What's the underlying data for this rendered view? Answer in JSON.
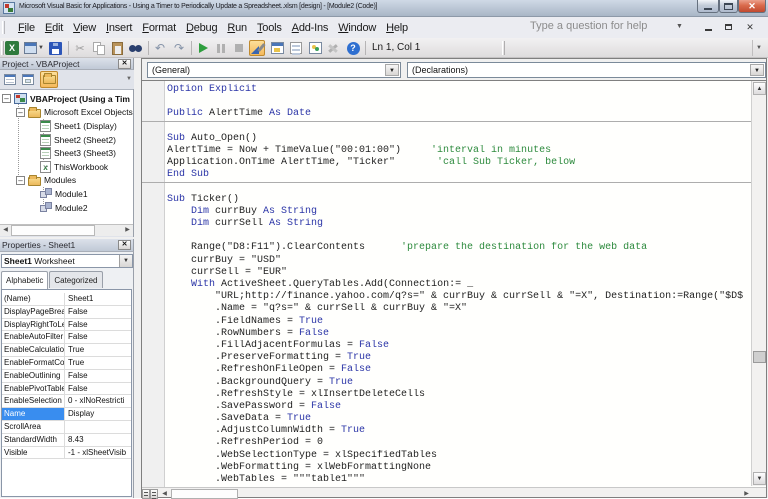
{
  "window": {
    "title": "Microsoft Visual Basic for Applications - Using a Timer to Periodically Update a Spreadsheet..xlsm [design] - [Module2 (Code)]"
  },
  "menu": {
    "items": [
      "File",
      "Edit",
      "View",
      "Insert",
      "Format",
      "Debug",
      "Run",
      "Tools",
      "Add-Ins",
      "Window",
      "Help"
    ],
    "help_box": "Type a question for help"
  },
  "toolbar": {
    "position": "Ln 1, Col 1"
  },
  "project": {
    "title": "Project - VBAProject",
    "tree": [
      {
        "label": "VBAProject (Using a Tim",
        "level": 0,
        "icon": "vba-project",
        "bold": true,
        "exp": true
      },
      {
        "label": "Microsoft Excel Objects",
        "level": 1,
        "icon": "folder",
        "exp": true
      },
      {
        "label": "Sheet1 (Display)",
        "level": 2,
        "icon": "sheet"
      },
      {
        "label": "Sheet2 (Sheet2)",
        "level": 2,
        "icon": "sheet"
      },
      {
        "label": "Sheet3 (Sheet3)",
        "level": 2,
        "icon": "sheet"
      },
      {
        "label": "ThisWorkbook",
        "level": 2,
        "icon": "workbook"
      },
      {
        "label": "Modules",
        "level": 1,
        "icon": "folder",
        "exp": true
      },
      {
        "label": "Module1",
        "level": 2,
        "icon": "module"
      },
      {
        "label": "Module2",
        "level": 2,
        "icon": "module"
      }
    ]
  },
  "properties": {
    "title": "Properties - Sheet1",
    "object_name": "Sheet1",
    "object_type": "Worksheet",
    "tabs": [
      "Alphabetic",
      "Categorized"
    ],
    "selected_property": "Name",
    "rows": [
      {
        "name": "(Name)",
        "value": "Sheet1"
      },
      {
        "name": "DisplayPageBreak",
        "value": "False"
      },
      {
        "name": "DisplayRightToLef",
        "value": "False"
      },
      {
        "name": "EnableAutoFilter",
        "value": "False"
      },
      {
        "name": "EnableCalculation",
        "value": "True"
      },
      {
        "name": "EnableFormatCon",
        "value": "True"
      },
      {
        "name": "EnableOutlining",
        "value": "False"
      },
      {
        "name": "EnablePivotTable",
        "value": "False"
      },
      {
        "name": "EnableSelection",
        "value": "0 - xlNoRestricti"
      },
      {
        "name": "Name",
        "value": "Display",
        "selected": true
      },
      {
        "name": "ScrollArea",
        "value": ""
      },
      {
        "name": "StandardWidth",
        "value": "8.43"
      },
      {
        "name": "Visible",
        "value": "-1 - xlSheetVisib"
      }
    ]
  },
  "code": {
    "left_dropdown": "(General)",
    "right_dropdown": "(Declarations)",
    "lines": [
      [
        [
          "k",
          "Option Explicit"
        ]
      ],
      [],
      [
        [
          "k",
          "Public "
        ],
        [
          "n",
          "AlertTime"
        ],
        [
          "k",
          " As Date"
        ]
      ],
      [],
      [
        [
          "k",
          "Sub "
        ],
        [
          "n",
          "Auto_Open()"
        ]
      ],
      [
        [
          "n",
          "AlertTime = Now + TimeValue(\"00:01:00\")     "
        ],
        [
          "c",
          "'interval in minutes"
        ]
      ],
      [
        [
          "n",
          "Application.OnTime AlertTime, \"Ticker\"       "
        ],
        [
          "c",
          "'call Sub Ticker, below"
        ]
      ],
      [
        [
          "k",
          "End Sub"
        ]
      ],
      [],
      [
        [
          "k",
          "Sub "
        ],
        [
          "n",
          "Ticker()"
        ]
      ],
      [
        [
          "n",
          "    "
        ],
        [
          "k",
          "Dim "
        ],
        [
          "n",
          "currBuy "
        ],
        [
          "k",
          "As String"
        ]
      ],
      [
        [
          "n",
          "    "
        ],
        [
          "k",
          "Dim "
        ],
        [
          "n",
          "currSell "
        ],
        [
          "k",
          "As String"
        ]
      ],
      [],
      [
        [
          "n",
          "    Range(\"D8:F11\").ClearContents      "
        ],
        [
          "c",
          "'prepare the destination for the web data"
        ]
      ],
      [
        [
          "n",
          "    currBuy = \"USD\""
        ]
      ],
      [
        [
          "n",
          "    currSell = \"EUR\""
        ]
      ],
      [
        [
          "n",
          "    "
        ],
        [
          "k",
          "With "
        ],
        [
          "n",
          "ActiveSheet.QueryTables.Add(Connection:= _"
        ]
      ],
      [
        [
          "n",
          "        \"URL;http://finance.yahoo.com/q?s=\" & currBuy & currSell & \"=X\", Destination:=Range(\"$D$"
        ]
      ],
      [
        [
          "n",
          "        .Name = \"q?s=\" & currSell & currBuy & \"=X\""
        ]
      ],
      [
        [
          "n",
          "        .FieldNames = "
        ],
        [
          "k",
          "True"
        ]
      ],
      [
        [
          "n",
          "        .RowNumbers = "
        ],
        [
          "k",
          "False"
        ]
      ],
      [
        [
          "n",
          "        .FillAdjacentFormulas = "
        ],
        [
          "k",
          "False"
        ]
      ],
      [
        [
          "n",
          "        .PreserveFormatting = "
        ],
        [
          "k",
          "True"
        ]
      ],
      [
        [
          "n",
          "        .RefreshOnFileOpen = "
        ],
        [
          "k",
          "False"
        ]
      ],
      [
        [
          "n",
          "        .BackgroundQuery = "
        ],
        [
          "k",
          "True"
        ]
      ],
      [
        [
          "n",
          "        .RefreshStyle = xlInsertDeleteCells"
        ]
      ],
      [
        [
          "n",
          "        .SavePassword = "
        ],
        [
          "k",
          "False"
        ]
      ],
      [
        [
          "n",
          "        .SaveData = "
        ],
        [
          "k",
          "True"
        ]
      ],
      [
        [
          "n",
          "        .AdjustColumnWidth = "
        ],
        [
          "k",
          "True"
        ]
      ],
      [
        [
          "n",
          "        .RefreshPeriod = 0"
        ]
      ],
      [
        [
          "n",
          "        .WebSelectionType = xlSpecifiedTables"
        ]
      ],
      [
        [
          "n",
          "        .WebFormatting = xlWebFormattingNone"
        ]
      ],
      [
        [
          "n",
          "        .WebTables = \"\"\"table1\"\"\""
        ]
      ]
    ]
  }
}
